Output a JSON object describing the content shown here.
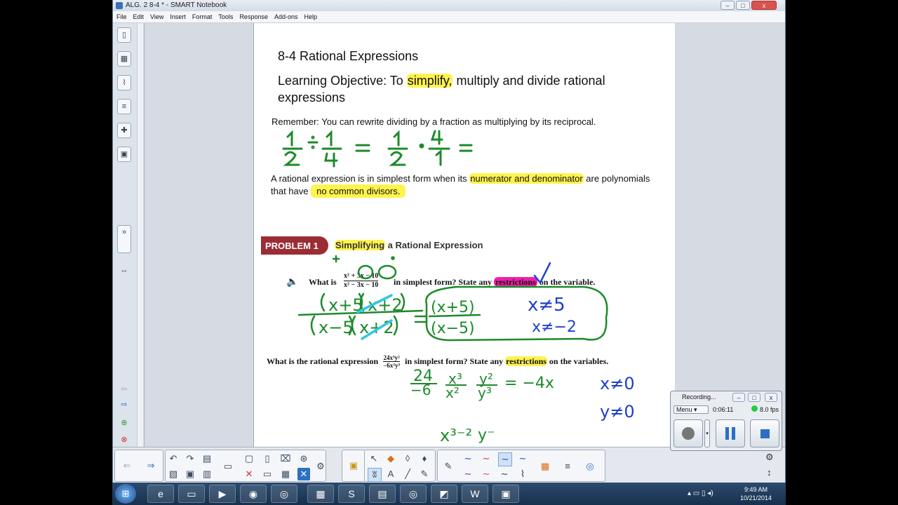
{
  "window": {
    "title": "ALG. 2 8-4 * - SMART Notebook",
    "minimize": "–",
    "maximize": "□",
    "close": "x"
  },
  "menu": [
    "File",
    "Edit",
    "View",
    "Insert",
    "Format",
    "Tools",
    "Response",
    "Add-ons",
    "Help"
  ],
  "page": {
    "heading": "8-4 Rational Expressions",
    "objective_prefix": "Learning Objective: To ",
    "objective_highlight": "simplify,",
    "objective_suffix": " multiply and divide rational",
    "objective_line2": "expressions",
    "remember": "Remember: You can rewrite dividing by a fraction as multiplying by its reciprocal.",
    "simplest_prefix": "A rational expression is in simplest form when its ",
    "simplest_highlight": "numerator and denominator",
    "simplest_suffix": " are polynomials",
    "simplest_line2_prefix": "that have ",
    "simplest_line2_highlight": "no common divisors.",
    "problem_badge": "PROBLEM 1",
    "problem_title_highlight": "Simplifying",
    "problem_title_rest": " a Rational Expression",
    "q1_prefix": "What is",
    "q1_suffix": "in simplest form? State any",
    "q1_highlight": "restrictions",
    "q1_end": "on the variable.",
    "q2_prefix": "What is the rational expression",
    "q2_suffix": "in simplest form? State any",
    "q2_highlight": "restrictions",
    "q2_end": "on the variables.",
    "ink_colors": {
      "green": "#1d8a2a",
      "blue": "#1f3fd0",
      "cyan": "#31c7e6",
      "magenta": "#ef1fa8",
      "highlight": "#fff34d"
    }
  },
  "recorder": {
    "title": "Recording...",
    "menu": "Menu",
    "time": "0:06:11",
    "fps": "8.0 fps"
  },
  "clock": {
    "time": "9:49 AM",
    "date": "10/21/2014"
  }
}
